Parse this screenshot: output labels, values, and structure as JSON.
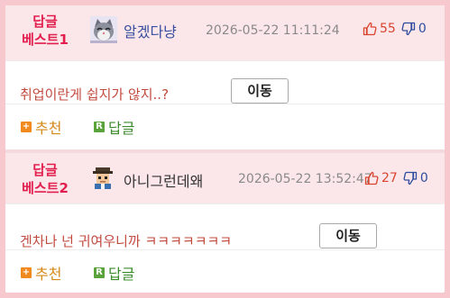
{
  "posts": [
    {
      "badge_line1": "답글",
      "badge_line2": "베스트1",
      "nickname": "알겠다냥",
      "avatar_icon": "cat-avatar-icon",
      "timestamp": "2026-05-22 11:11:24",
      "upvotes": "55",
      "downvotes": "0",
      "content": "취업이란게 쉽지가 않지..?",
      "move_label": "이동",
      "recommend_label": "추천",
      "reply_label": "답글"
    },
    {
      "badge_line1": "답글",
      "badge_line2": "베스트2",
      "nickname": "아니그런데왜",
      "avatar_icon": "pixel-person-avatar-icon",
      "timestamp": "2026-05-22 13:52:47",
      "upvotes": "27",
      "downvotes": "0",
      "content": "겐차나 넌 귀여우니까 ㅋㅋㅋㅋㅋㅋㅋ",
      "move_label": "이동",
      "recommend_label": "추천",
      "reply_label": "답글"
    }
  ],
  "colors": {
    "background": "#f7c9cf",
    "header_bg": "#fbe6e9",
    "badge": "#e21e4e",
    "upvote": "#d8452e",
    "downvote": "#2e4d9e",
    "recommend": "#d48a1a",
    "reply": "#3b8a2b"
  }
}
